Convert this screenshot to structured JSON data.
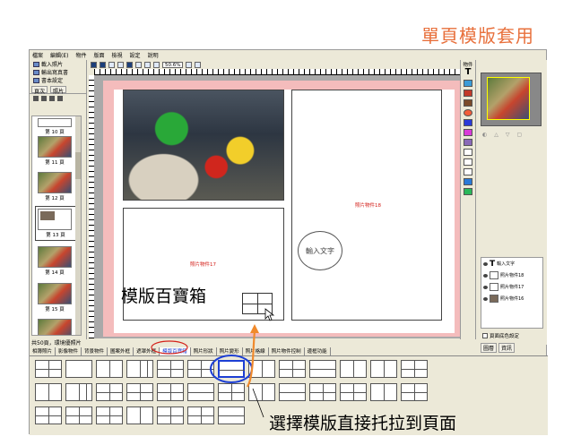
{
  "heading": "單頁模版套用",
  "menu": [
    "檔案",
    "編輯(E)",
    "物件",
    "版面",
    "檢視",
    "設定",
    "說明"
  ],
  "left_panel": {
    "commands": [
      "載入照片",
      "輸出寫真書",
      "書本設定"
    ],
    "tabs": [
      "頁次",
      "照片"
    ],
    "thumbnails": [
      {
        "label": "第 10 頁",
        "photo": false
      },
      {
        "label": "第 11 頁",
        "photo": true
      },
      {
        "label": "第 12 頁",
        "photo": true
      },
      {
        "label": "第 13 頁",
        "photo": false,
        "selected": true
      },
      {
        "label": "第 14 頁",
        "photo": true
      },
      {
        "label": "第 15 頁",
        "photo": true
      }
    ]
  },
  "toolbar": {
    "zoom": "50.6%"
  },
  "canvas": {
    "slot_right_label": "照片物件18",
    "slot_bottom_label": "照片物件17",
    "bubble_text": "輸入文字"
  },
  "callouts": {
    "gallery_name": "模版百寶箱",
    "drag_hint": "選擇模版直接托拉到頁面"
  },
  "right_panel": {
    "title": "物件",
    "layers": [
      {
        "label": "輸入文字",
        "type": "text"
      },
      {
        "label": "照片物件18",
        "type": "frame"
      },
      {
        "label": "照片物件17",
        "type": "frame"
      },
      {
        "label": "照片物件16",
        "type": "photo"
      }
    ],
    "checkbox_label": "頁面底色設定",
    "tabs": [
      "圖層",
      "資訊"
    ]
  },
  "statusbar": "共50頁，環境優照片",
  "bottom_tabs": [
    "相簿照片",
    "影像物件",
    "背景物件",
    "圖案外框",
    "遮罩外框",
    "模版百寶箱",
    "照片形狀",
    "照片變形",
    "照片格線",
    "照片物件控制",
    "邊框功能"
  ],
  "active_tab_index": 5,
  "colors": {
    "heading": "#e8703c",
    "page_border": "#f4bcbc",
    "highlight": "#1d3fd4",
    "arrow": "#f08a2c",
    "label_red": "#d4201a"
  }
}
